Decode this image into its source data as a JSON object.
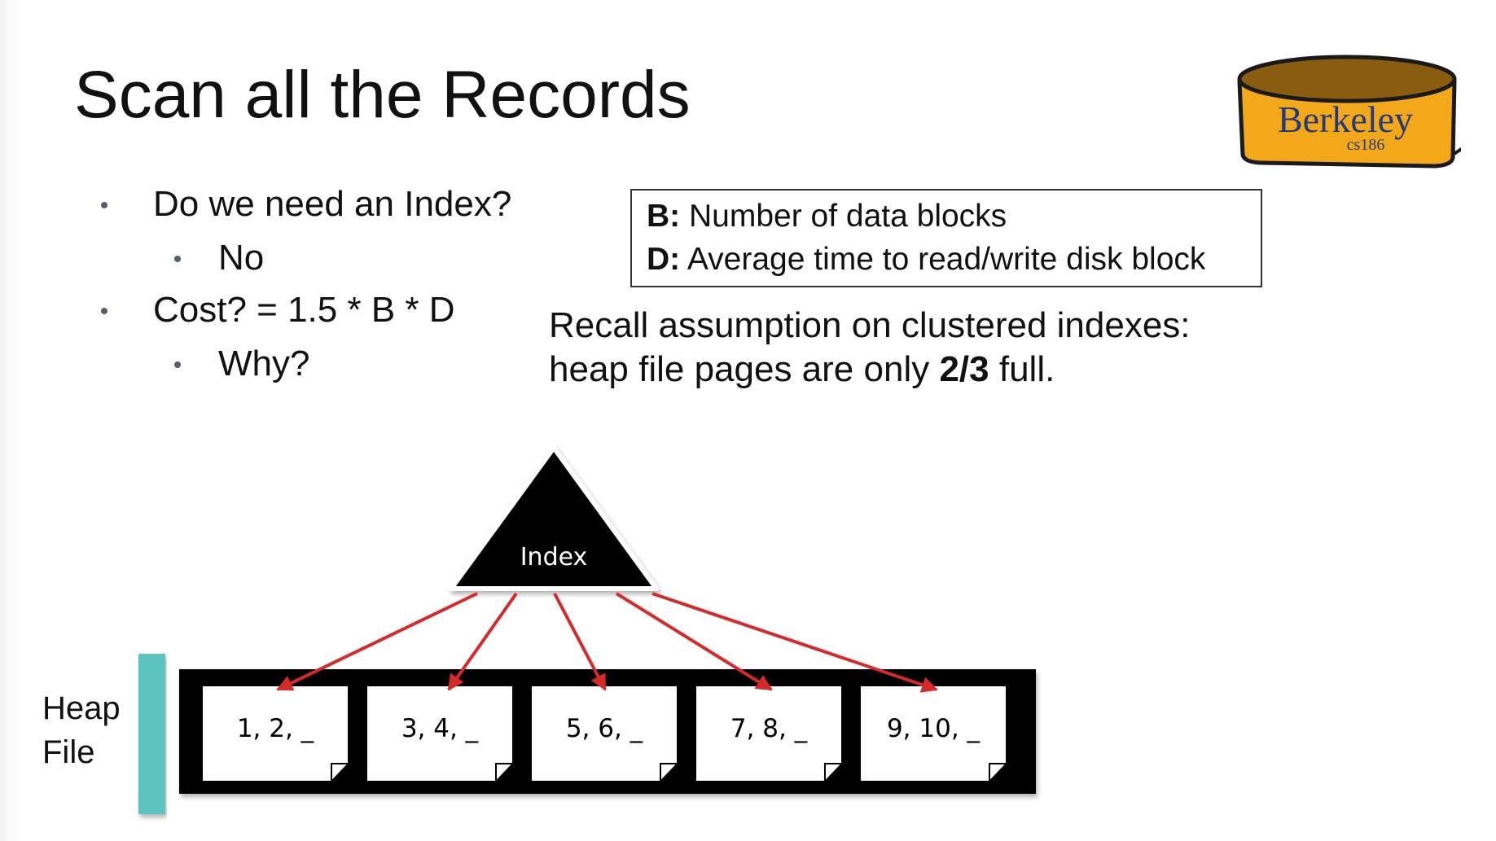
{
  "slide": {
    "title": "Scan all the Records",
    "bullets": [
      {
        "text": "Do we need an Index?",
        "level": 1
      },
      {
        "text": "No",
        "level": 2
      },
      {
        "text": "Cost? = 1.5 * B * D",
        "level": 1
      },
      {
        "text": "Why?",
        "level": 2
      }
    ],
    "definitions": [
      {
        "term": "B:",
        "text": " Number of data blocks"
      },
      {
        "term": "D:",
        "text": " Average time to read/write disk block"
      }
    ],
    "recall": {
      "line1": "Recall assumption on clustered indexes:",
      "line2_pre": "heap file pages are only ",
      "line2_bold": "2/3",
      "line2_post": " full."
    }
  },
  "diagram": {
    "index_label": "Index",
    "heap_label_line1": "Heap",
    "heap_label_line2": "File",
    "pages": [
      "1, 2, _",
      "3, 4, _",
      "5, 6, _",
      "7, 8, _",
      "9, 10, _"
    ]
  },
  "logo": {
    "text": "Berkeley",
    "subtext": "cs186"
  },
  "colors": {
    "arrow": "#d42a2a",
    "teal_bar": "#5dc3bf",
    "logo_fill": "#f2a818",
    "logo_rim": "#8a5c10",
    "logo_text": "#243a7a"
  }
}
